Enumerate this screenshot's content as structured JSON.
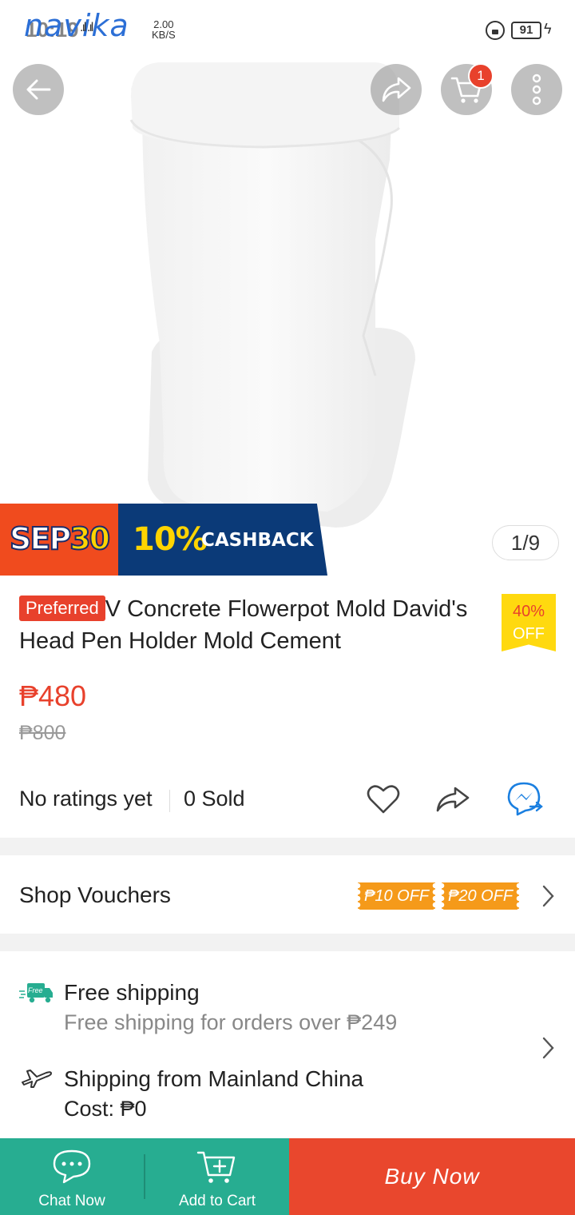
{
  "status_bar": {
    "brand": "navika",
    "time": "10:19",
    "net_speed_value": "2.00",
    "net_speed_unit": "KB/S",
    "battery": "91"
  },
  "top_bar": {
    "cart_count": "1"
  },
  "promo": {
    "date_prefix": "SEP",
    "date_num": "30",
    "cashback_pct": "10%",
    "cashback_label": "CASHBACK"
  },
  "gallery": {
    "counter": "1/9"
  },
  "product": {
    "badge": "Preferred",
    "title": "V Concrete Flowerpot Mold David's Head Pen Holder Mold Cement",
    "discount_pct": "40%",
    "discount_off": "OFF",
    "price": "₱480",
    "old_price": "₱800",
    "ratings": "No ratings yet",
    "sold": "0 Sold"
  },
  "vouchers": {
    "label": "Shop Vouchers",
    "items": [
      "₱10 OFF",
      "₱20 OFF"
    ]
  },
  "shipping": {
    "free_badge": "Free",
    "free_title": "Free shipping",
    "free_sub": "Free shipping for orders over ₱249",
    "from_title": "Shipping from Mainland China",
    "cost": "Cost: ₱0"
  },
  "bottom_bar": {
    "chat_label": "Chat Now",
    "cart_label": "Add to Cart",
    "buy_label": "Buy Now"
  },
  "colors": {
    "accent": "#e8412c",
    "green": "#27ad91",
    "voucher": "#f59a1a",
    "promo_blue": "#0b3a78",
    "discount_yellow": "#ffd90f"
  }
}
